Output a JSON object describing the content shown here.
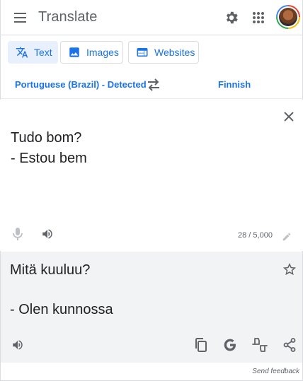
{
  "header": {
    "title": "Translate",
    "menu_icon": "hamburger-menu-icon",
    "settings_icon": "gear-icon",
    "apps_icon": "apps-grid-icon",
    "avatar": "user-avatar"
  },
  "tabs": [
    {
      "label": "Text",
      "icon": "translate-icon",
      "active": true
    },
    {
      "label": "Images",
      "icon": "image-icon",
      "active": false
    },
    {
      "label": "Websites",
      "icon": "web-icon",
      "active": false
    }
  ],
  "languages": {
    "source": "Portuguese (Brazil) - Detected",
    "target": "Finnish",
    "swap_icon": "swap-arrows-icon"
  },
  "source": {
    "lines": [
      "Tudo bom?",
      "- Estou bem"
    ],
    "char_count": "28 / 5,000",
    "clear_icon": "close-icon",
    "mic_icon": "microphone-icon",
    "speaker_icon": "volume-icon",
    "edit_icon": "pencil-icon"
  },
  "target": {
    "lines": [
      "Mitä kuuluu?",
      "",
      "- Olen kunnossa"
    ],
    "star_icon": "star-outline-icon",
    "speaker_icon": "volume-icon",
    "copy_icon": "copy-icon",
    "google_icon": "google-g-icon",
    "rate_icon": "rate-translation-icon",
    "share_icon": "share-icon"
  },
  "footer": {
    "feedback": "Send feedback"
  },
  "colors": {
    "accent": "#1a73e8",
    "icon": "#5f6368",
    "active_tab_bg": "#e8f0fe",
    "target_bg": "#f1f3f4"
  }
}
